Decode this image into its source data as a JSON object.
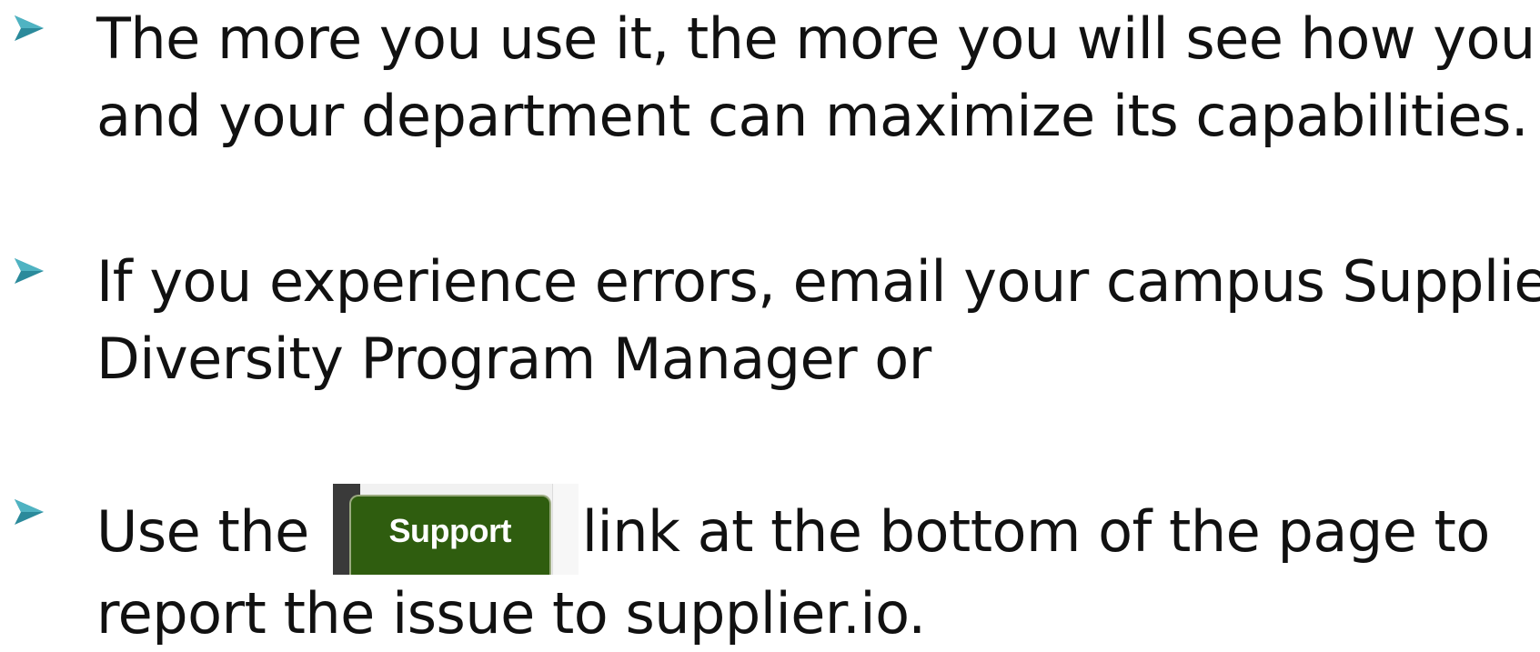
{
  "colors": {
    "bullet_arrow": "#2b8a9b",
    "support_button_bg": "#2f5d0f",
    "text": "#111111"
  },
  "bullet_icon": "right-arrowhead-icon",
  "bullets": [
    {
      "line1": "The more you use it, the more you will see how you",
      "line2": "and your department can maximize its capabilities."
    },
    {
      "line1": "If you experience errors, email your campus Supplier",
      "line2": "Diversity Program Manager or"
    },
    {
      "line1_before": "Use the",
      "support_label": "Support",
      "line1_after": "link at the bottom of the page to",
      "line2": "report the issue to supplier.io."
    }
  ]
}
